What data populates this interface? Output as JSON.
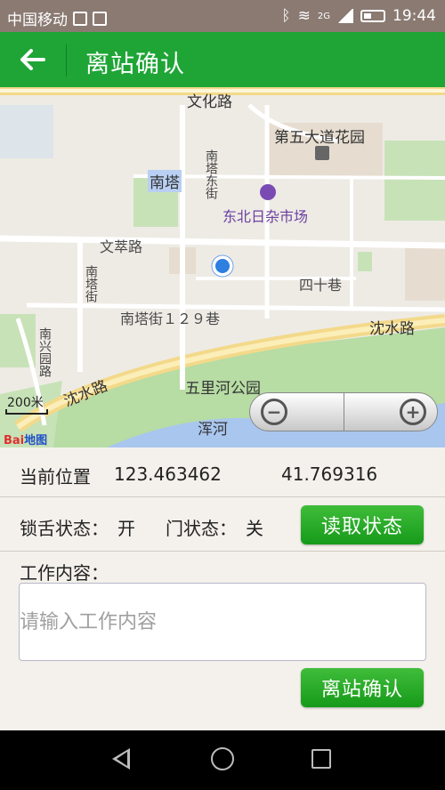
{
  "status_bar": {
    "carrier": "中国移动",
    "network": "2G",
    "time": "19:44",
    "icons": [
      "image-icon",
      "sim-icon",
      "bluetooth-icon",
      "wifi-icon",
      "signal-icon",
      "battery-icon"
    ]
  },
  "title_bar": {
    "back_icon": "arrow-left-icon",
    "title": "离站确认",
    "bg_color": "#1ea536"
  },
  "map": {
    "labels": {
      "wenhua_road": "文化路",
      "wuda_garden": "第五大道花园",
      "nanta": "南塔",
      "nanta_east_st": "南塔东街",
      "northeast_market": "东北日杂市场",
      "wencui_road": "文萃路",
      "sishi_lane": "四十巷",
      "nanta_st": "南塔街",
      "nanta_129": "南塔街１２９巷",
      "shenshui_road_right": "沈水路",
      "shenshui_road_left": "沈水路",
      "nanxing_road": "南兴园路",
      "wulihe_park": "五里河公园",
      "hunhe": "浑河"
    },
    "scale": "200米",
    "logo_text": "Bai",
    "logo_suffix": "地图",
    "zoom_out_icon": "zoom-out-icon",
    "zoom_in_icon": "zoom-in-icon"
  },
  "location": {
    "label": "当前位置",
    "longitude": "123.463462",
    "latitude": "41.769316"
  },
  "status": {
    "lock_label": "锁舌状态：",
    "lock_value": "开",
    "door_label": "门状态：",
    "door_value": "关",
    "read_button": "读取状态"
  },
  "work": {
    "label": "工作内容：",
    "placeholder": "请输入工作内容",
    "value": ""
  },
  "confirm_button": "离站确认",
  "nav_bar": {
    "back_icon": "nav-back-icon",
    "home_icon": "nav-home-icon",
    "recent_icon": "nav-recent-icon"
  }
}
